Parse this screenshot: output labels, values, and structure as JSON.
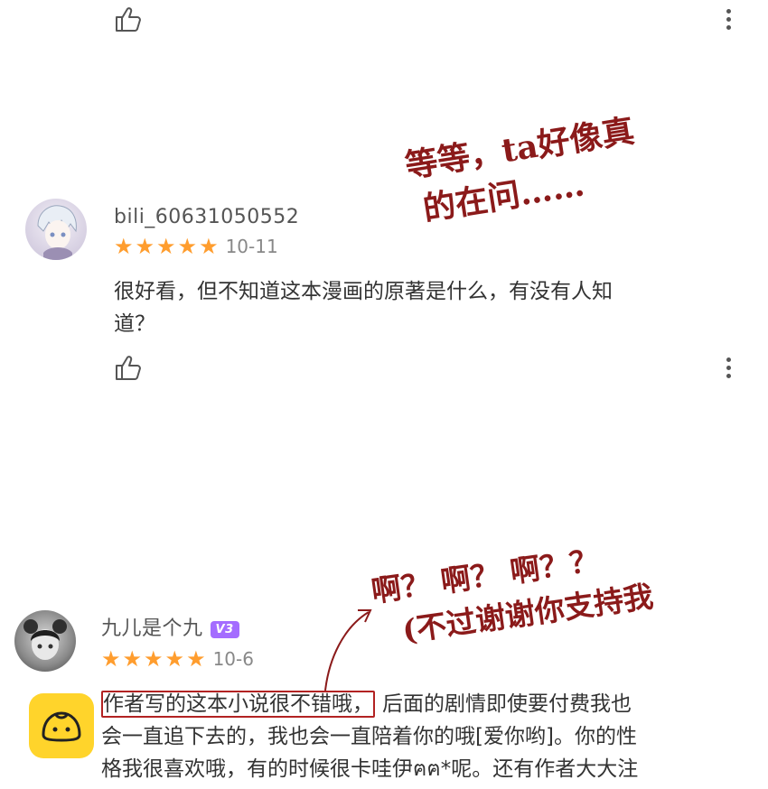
{
  "colors": {
    "star": "#ff9d2e",
    "annotation": "#8b1a1a",
    "badge": "#a46cff",
    "app_icon": "#ffd42b"
  },
  "icons": {
    "like": "thumbs-up-icon",
    "more": "more-vert-icon",
    "app": "bun-app-icon"
  },
  "comments": [
    {
      "username": "bili_60631050552",
      "rating": 5,
      "date": "10-11",
      "text_line1": "很好看，但不知道这本漫画的原著是什么，有没有人知",
      "text_line2": "道？"
    },
    {
      "username": "九儿是个九",
      "badge": "V3",
      "rating": 5,
      "date": "10-6",
      "text_highlight": "作者写的这本小说很不错哦，",
      "text_rest1": "后面的剧情即使要付费我也",
      "text_line2": "会一直追下去的，我也会一直陪着你的哦[爱你哟]。你的性",
      "text_line3": "格我很喜欢哦，有的时候很卡哇伊ฅฅ*呢。还有作者大大注"
    }
  ],
  "annotations": {
    "note1_line1": "等等，ta好像真",
    "note1_line2": "的在问……",
    "note2_line1": "啊？ 啊？ 啊？？",
    "note2_line2": "(不过谢谢你支持我"
  }
}
